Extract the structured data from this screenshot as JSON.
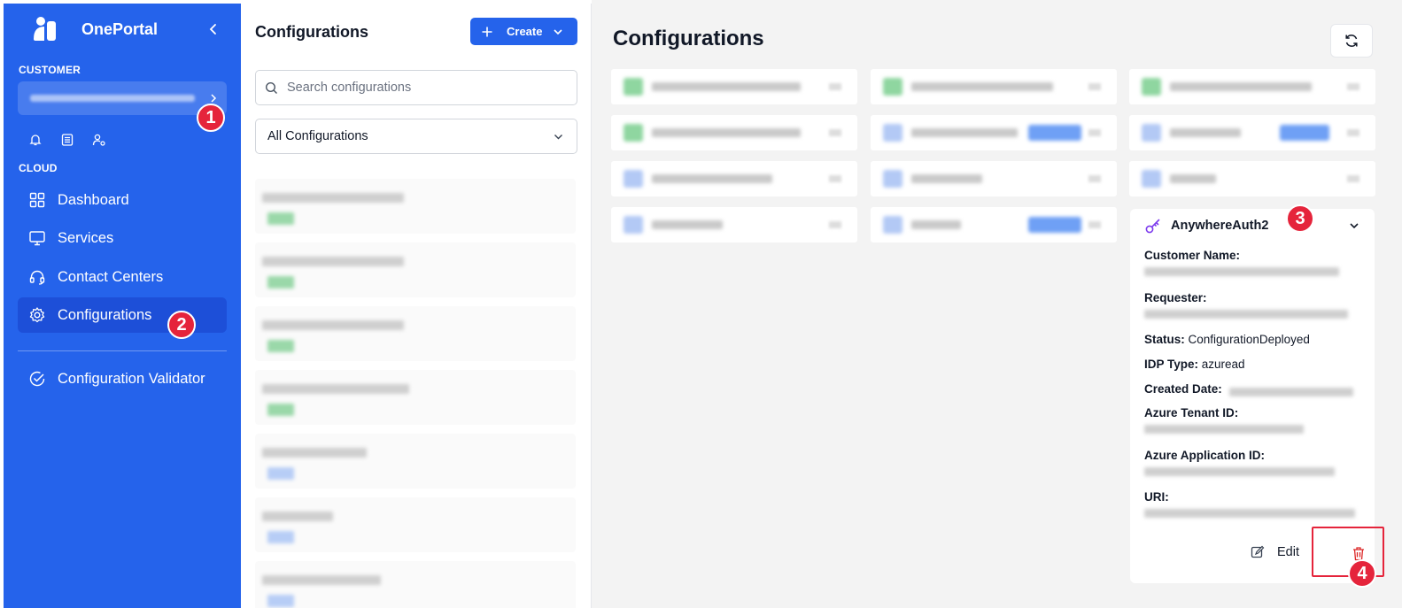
{
  "sidebar": {
    "app_name": "OnePortal",
    "customer_label": "CUSTOMER",
    "cloud_label": "CLOUD",
    "nav": [
      {
        "label": "Dashboard",
        "icon": "grid-icon"
      },
      {
        "label": "Services",
        "icon": "monitor-icon"
      },
      {
        "label": "Contact Centers",
        "icon": "headset-icon"
      },
      {
        "label": "Configurations",
        "icon": "gear-icon",
        "active": true
      },
      {
        "label": "Configuration Validator",
        "icon": "check-circle-icon"
      }
    ]
  },
  "list_panel": {
    "title": "Configurations",
    "create_label": "Create",
    "search_placeholder": "Search configurations",
    "filter_value": "All Configurations"
  },
  "main": {
    "title": "Configurations",
    "detail": {
      "name": "AnywhereAuth2",
      "customer_name_label": "Customer Name:",
      "requester_label": "Requester:",
      "status_label": "Status:",
      "status_value": "ConfigurationDeployed",
      "idp_type_label": "IDP Type:",
      "idp_type_value": "azuread",
      "created_date_label": "Created Date:",
      "azure_tenant_label": "Azure Tenant ID:",
      "azure_app_label": "Azure Application ID:",
      "uri_label": "URI:",
      "edit_label": "Edit"
    }
  },
  "annotations": {
    "badge1": "1",
    "badge2": "2",
    "badge3": "3",
    "badge4": "4"
  },
  "colors": {
    "primary": "#2563eb",
    "annotation_red": "#e5243b",
    "key_icon": "#7c3aed",
    "delete_icon": "#dc2626"
  }
}
